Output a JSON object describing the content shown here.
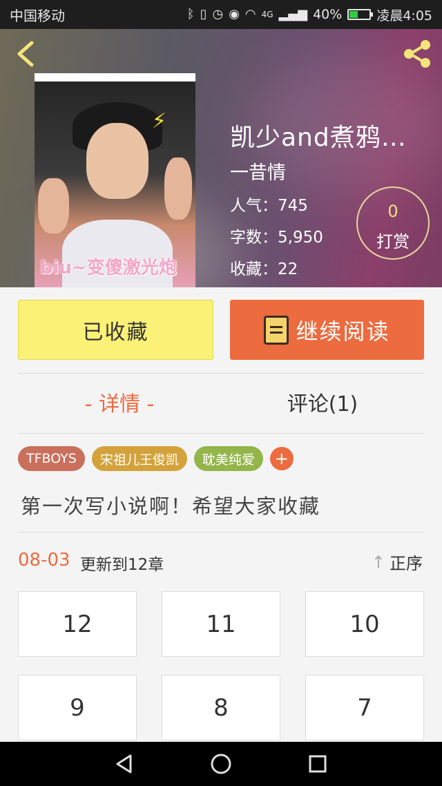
{
  "status_bar": {
    "carrier": "中国移动",
    "network": "4G",
    "battery": "40%",
    "battery_level": 0.4,
    "time": "凌晨4:05"
  },
  "header": {
    "back_icon": "chevron-left-icon",
    "share_icon": "share-icon"
  },
  "book": {
    "cover_caption": "biu~变傻激光炮",
    "title": "凯少and煮鸦…",
    "author": "一昔情",
    "popularity": "人气：745",
    "word_count": "字数：5,950",
    "favorites": "收藏：22",
    "reward_count": "0",
    "reward_label": "打赏"
  },
  "actions": {
    "collected_label": "已收藏",
    "continue_label": "继续阅读"
  },
  "tabs": {
    "detail": "- 详情 -",
    "comments": "评论(1)"
  },
  "tags": [
    {
      "label": "TFBOYS",
      "color": "#c96f5c"
    },
    {
      "label": "宋祖儿王俊凯",
      "color": "#d3a23a"
    },
    {
      "label": "耽美纯爱",
      "color": "#94b54a"
    }
  ],
  "tag_add_label": "+",
  "intro": "第一次写小说啊！希望大家收藏",
  "update": {
    "date": "08-03",
    "text": "更新到12章",
    "sort_label": "正序"
  },
  "chapters": [
    "12",
    "11",
    "10",
    "9",
    "8",
    "7"
  ],
  "colors": {
    "accent": "#ec6b3f",
    "collected_bg": "#fbf177"
  }
}
